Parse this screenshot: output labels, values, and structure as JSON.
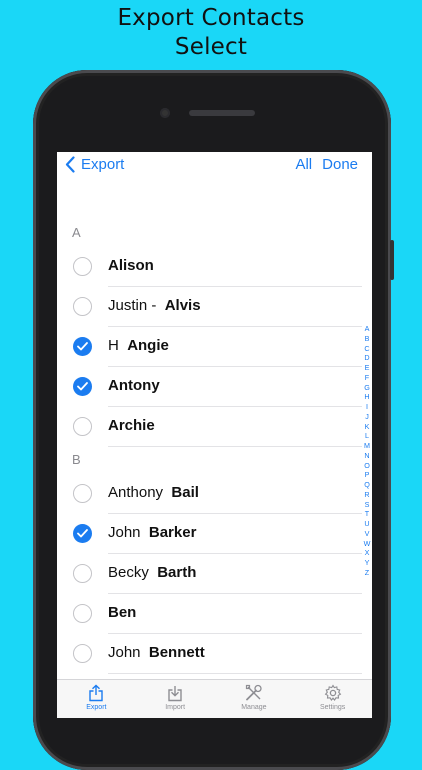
{
  "headline": {
    "line1": "Export Contacts",
    "line2": "Select"
  },
  "nav": {
    "back_label": "Export",
    "all_label": "All",
    "done_label": "Done"
  },
  "sections": [
    {
      "letter": "A",
      "contacts": [
        {
          "first": "",
          "last": "Alison",
          "checked": false
        },
        {
          "first": "Justin -",
          "last": "Alvis",
          "checked": false
        },
        {
          "first": "H",
          "last": "Angie",
          "checked": true
        },
        {
          "first": "",
          "last": "Antony",
          "checked": true
        },
        {
          "first": "",
          "last": "Archie",
          "checked": false
        }
      ]
    },
    {
      "letter": "B",
      "contacts": [
        {
          "first": "Anthony",
          "last": "Bail",
          "checked": false
        },
        {
          "first": "John",
          "last": "Barker",
          "checked": true
        },
        {
          "first": "Becky",
          "last": "Barth",
          "checked": false
        },
        {
          "first": "",
          "last": "Ben",
          "checked": false
        },
        {
          "first": "John",
          "last": "Bennett",
          "checked": false
        }
      ]
    }
  ],
  "index_letters": [
    "A",
    "B",
    "C",
    "D",
    "E",
    "F",
    "G",
    "H",
    "I",
    "J",
    "K",
    "L",
    "M",
    "N",
    "O",
    "P",
    "Q",
    "R",
    "S",
    "T",
    "U",
    "V",
    "W",
    "X",
    "Y",
    "Z"
  ],
  "tabs": [
    {
      "label": "Export",
      "icon": "share-icon",
      "active": true
    },
    {
      "label": "Import",
      "icon": "download-icon",
      "active": false
    },
    {
      "label": "Manage",
      "icon": "tools-icon",
      "active": false
    },
    {
      "label": "Settings",
      "icon": "gear-icon",
      "active": false
    }
  ],
  "colors": {
    "accent": "#1b7cf0",
    "background": "#1ad7f7"
  }
}
